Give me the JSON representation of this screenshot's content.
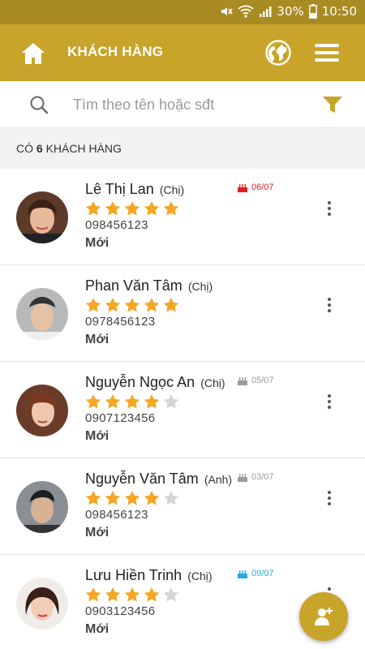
{
  "status_bar": {
    "battery": "30%",
    "time": "10:50",
    "icons": [
      "mute-icon",
      "wifi-icon",
      "signal-icon",
      "battery-icon"
    ]
  },
  "app_bar": {
    "title": "KHÁCH HÀNG",
    "home_icon": "home-icon",
    "globe_icon": "globe-icon",
    "menu_icon": "menu-icon"
  },
  "search": {
    "placeholder": "Tìm theo tên hoặc sđt",
    "icon": "search-icon",
    "filter_icon": "filter-icon"
  },
  "count_bar": {
    "prefix": "CÓ",
    "count": "6",
    "suffix": "KHÁCH HÀNG"
  },
  "colors": {
    "primary": "#c9a42a",
    "status_bar": "#a88b22",
    "star": "#f5a623",
    "star_empty": "#d6d6d6",
    "bday_red": "#e02020",
    "bday_grey": "#9a9a9a",
    "bday_blue": "#29a8e0"
  },
  "customers": [
    {
      "name": "Lê Thị Lan",
      "title": "(Chị)",
      "rating": 5,
      "phone": "098456123",
      "status": "Mới",
      "birthday": "06/07",
      "birthday_color": "red"
    },
    {
      "name": "Phan Văn Tâm",
      "title": "(Chị)",
      "rating": 5,
      "phone": "0978456123",
      "status": "Mới",
      "birthday": "",
      "birthday_color": ""
    },
    {
      "name": "Nguyễn Ngọc An",
      "title": "(Chị)",
      "rating": 4,
      "phone": "0907123456",
      "status": "Mới",
      "birthday": "05/07",
      "birthday_color": "grey"
    },
    {
      "name": "Nguyễn Văn Tâm",
      "title": "(Anh)",
      "rating": 4,
      "phone": "098456123",
      "status": "Mới",
      "birthday": "03/07",
      "birthday_color": "grey"
    },
    {
      "name": "Lưu Hiền Trinh",
      "title": "(Chị)",
      "rating": 4,
      "phone": "0903123456",
      "status": "Mới",
      "birthday": "09/07",
      "birthday_color": "blue"
    }
  ],
  "fab": {
    "icon": "add-user-icon"
  }
}
